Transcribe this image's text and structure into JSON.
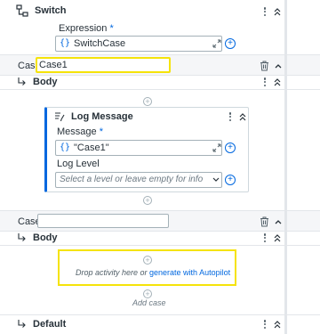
{
  "switch": {
    "title": "Switch",
    "expression_label": "Expression",
    "required_mark": "*",
    "expression_value": "SwitchCase"
  },
  "case1": {
    "case_label": "Case",
    "case_value": "Case1",
    "body_label": "Body"
  },
  "log_message": {
    "title": "Log Message",
    "message_label": "Message",
    "required_mark": "*",
    "message_value": "\"Case1\"",
    "log_level_label": "Log Level",
    "log_level_placeholder": "Select a level or leave empty for info"
  },
  "case2": {
    "case_label": "Case",
    "case_value": "",
    "body_label": "Body",
    "drop_text": "Drop activity here or ",
    "drop_link": "generate with Autopilot",
    "add_case": "Add case"
  },
  "default_section": {
    "label": "Default"
  },
  "colors": {
    "accent": "#0067df",
    "highlight": "#f5e30a",
    "header_bg": "#f5f6f8",
    "text": "#273139"
  },
  "icons": [
    "switch-icon",
    "more-vertical-icon",
    "collapse-chevron-icon",
    "curly-brace-icon",
    "expand-icon",
    "add-circle-icon",
    "case-arrow-icon",
    "trash-icon",
    "log-message-icon",
    "dropdown-chevron-icon"
  ]
}
